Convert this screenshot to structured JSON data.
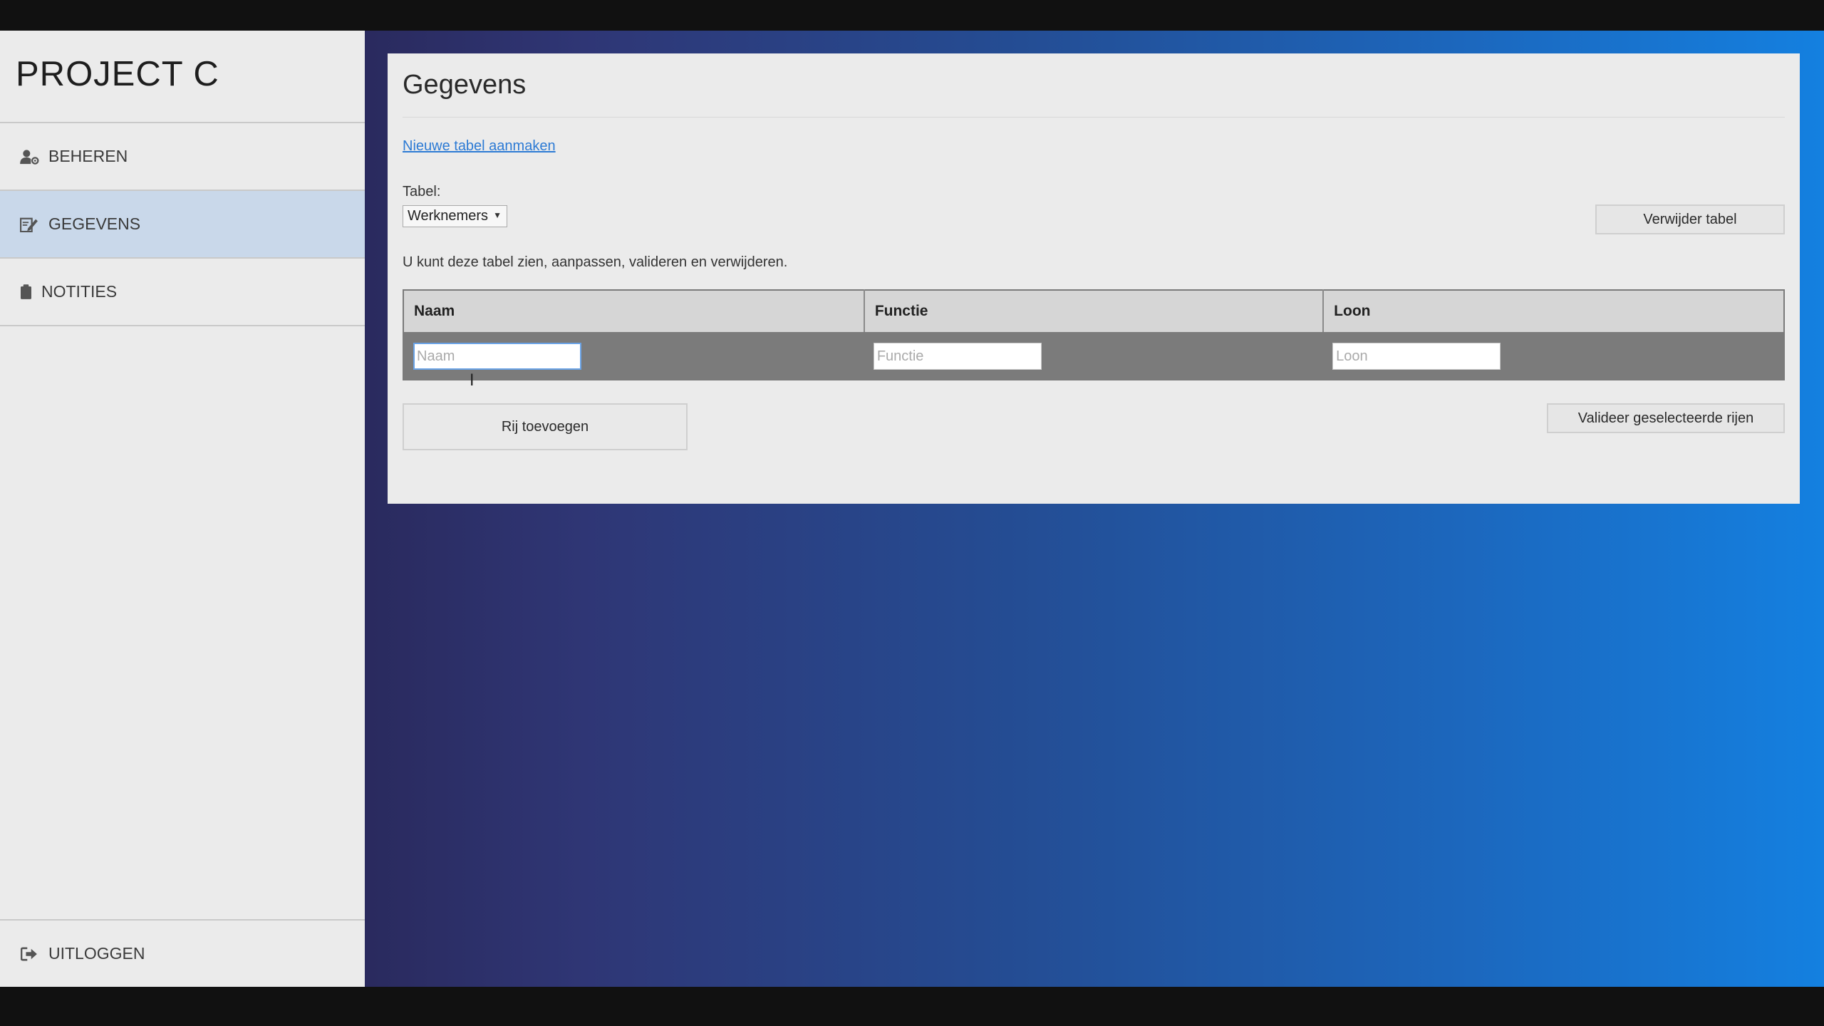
{
  "sidebar": {
    "brand": "PROJECT C",
    "items": [
      {
        "label": "BEHEREN",
        "icon": "user-cog-icon",
        "active": false
      },
      {
        "label": "GEGEVENS",
        "icon": "edit-icon",
        "active": true
      },
      {
        "label": "NOTITIES",
        "icon": "clipboard-icon",
        "active": false
      }
    ],
    "logout": {
      "label": "UITLOGGEN",
      "icon": "sign-out-icon"
    }
  },
  "main": {
    "title": "Gegevens",
    "new_table_link": "Nieuwe tabel aanmaken",
    "table_label": "Tabel:",
    "table_select": {
      "value": "Werknemers"
    },
    "delete_button": "Verwijder tabel",
    "description": "U kunt deze tabel zien, aanpassen, valideren en verwijderen.",
    "table": {
      "columns": [
        "Naam",
        "Functie",
        "Loon"
      ],
      "row_placeholders": [
        "Naam",
        "Functie",
        "Loon"
      ]
    },
    "add_row_button": "Rij toevoegen",
    "validate_button": "Valideer geselecteerde rijen"
  },
  "colors": {
    "sidebar_bg": "#ebebeb",
    "active_item_bg": "#c9d8ea",
    "link": "#2c7ad4",
    "gradient_start": "#2a2a5e",
    "gradient_end": "#1480e0"
  }
}
